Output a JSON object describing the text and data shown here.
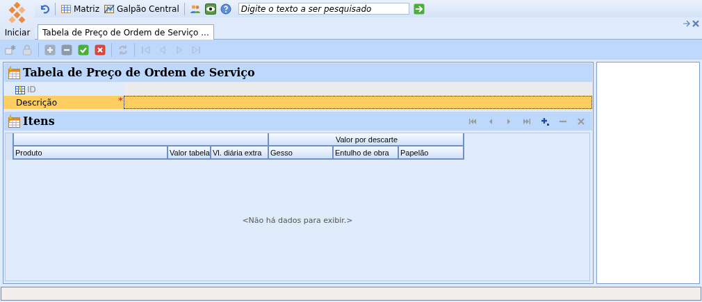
{
  "app_menu": {
    "label": "Iniciar"
  },
  "toolbar": {
    "items": [
      {
        "kind": "undo"
      },
      {
        "kind": "grid",
        "label": "Matriz"
      },
      {
        "kind": "chart",
        "label": "Galpão Central"
      },
      {
        "kind": "users"
      },
      {
        "kind": "eye"
      },
      {
        "kind": "help"
      }
    ],
    "search": {
      "placeholder": "Digite o texto a ser pesquisado"
    }
  },
  "tabs": [
    {
      "label": "Tabela de Preço de Ordem de Serviço ...",
      "selected": true
    }
  ],
  "actions": [
    {
      "kind": "new",
      "disabled": true
    },
    {
      "kind": "lock",
      "disabled": true
    },
    {
      "kind": "add",
      "disabled": true
    },
    {
      "kind": "remove",
      "disabled": true
    },
    {
      "kind": "confirm",
      "disabled": false
    },
    {
      "kind": "cancel",
      "disabled": false
    },
    {
      "kind": "refresh",
      "disabled": true
    },
    {
      "kind": "first",
      "disabled": true
    },
    {
      "kind": "prev",
      "disabled": true
    },
    {
      "kind": "next",
      "disabled": true
    },
    {
      "kind": "last",
      "disabled": true
    }
  ],
  "form": {
    "title": "Tabela de Preço de Ordem de Serviço",
    "fields": [
      {
        "label": "ID",
        "disabled": true,
        "focused": false
      },
      {
        "label": "Descrição",
        "disabled": false,
        "required_mark": "*",
        "focused": true
      }
    ]
  },
  "grid": {
    "title": "Itens",
    "nav": [
      {
        "kind": "first",
        "disabled": true
      },
      {
        "kind": "prev",
        "disabled": true
      },
      {
        "kind": "next",
        "disabled": true
      },
      {
        "kind": "last",
        "disabled": true
      },
      {
        "kind": "add",
        "disabled": false
      },
      {
        "kind": "remove",
        "disabled": true
      },
      {
        "kind": "delete",
        "disabled": true
      }
    ],
    "column_groups": [
      {
        "columns": [
          {
            "label": "Produto"
          },
          {
            "label": "Valor tabela"
          },
          {
            "label": "Vl. diária extra"
          }
        ]
      },
      {
        "label": "Valor por descarte",
        "columns": [
          {
            "label": "Gesso"
          },
          {
            "label": "Entulho de obra"
          },
          {
            "label": "Papelão"
          }
        ]
      }
    ],
    "empty_text": "<Não há dados para exibir.>"
  }
}
